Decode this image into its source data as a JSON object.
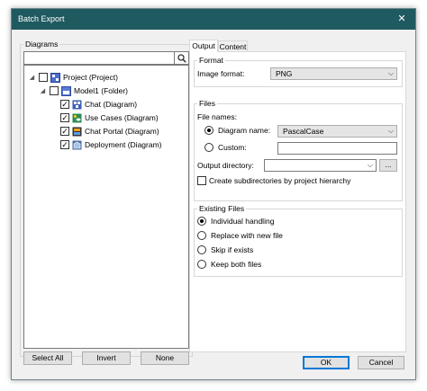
{
  "window": {
    "title": "Batch Export"
  },
  "diagrams": {
    "group_label": "Diagrams",
    "search": {
      "value": ""
    },
    "tree": [
      {
        "label": "Project (Project)",
        "expander": "◢",
        "checked": false,
        "icon": "project-icon"
      },
      {
        "label": "Model1 (Folder)",
        "expander": "◢",
        "checked": false,
        "icon": "folder-icon"
      },
      {
        "label": "Chat (Diagram)",
        "checked": true,
        "icon": "chat-diagram-icon"
      },
      {
        "label": "Use Cases (Diagram)",
        "checked": true,
        "icon": "use-case-diagram-icon"
      },
      {
        "label": "Chat Portal (Diagram)",
        "checked": true,
        "icon": "chat-portal-diagram-icon"
      },
      {
        "label": "Deployment (Diagram)",
        "checked": true,
        "icon": "deployment-diagram-icon"
      }
    ],
    "buttons": {
      "select_all": "Select All",
      "invert": "Invert",
      "none": "None"
    }
  },
  "tabs": [
    {
      "label": "Output",
      "active": true
    },
    {
      "label": "Content",
      "active": false
    }
  ],
  "format": {
    "group_label": "Format",
    "image_format_label": "Image format:",
    "image_format_value": "PNG"
  },
  "files": {
    "group_label": "Files",
    "file_names_label": "File names:",
    "diagram_name_label": "Diagram name:",
    "diagram_name_value": "PascalCase",
    "custom_label": "Custom:",
    "custom_value": "",
    "output_directory_label": "Output directory:",
    "output_directory_value": "",
    "browse_label": "...",
    "subdirectories_label": "Create subdirectories by project hierarchy",
    "subdirectories_checked": false
  },
  "existing_files": {
    "group_label": "Existing Files",
    "options": [
      {
        "label": "Individual handling",
        "selected": true
      },
      {
        "label": "Replace with new file",
        "selected": false
      },
      {
        "label": "Skip if exists",
        "selected": false
      },
      {
        "label": "Keep both files",
        "selected": false
      }
    ]
  },
  "footer": {
    "ok": "OK",
    "cancel": "Cancel"
  }
}
